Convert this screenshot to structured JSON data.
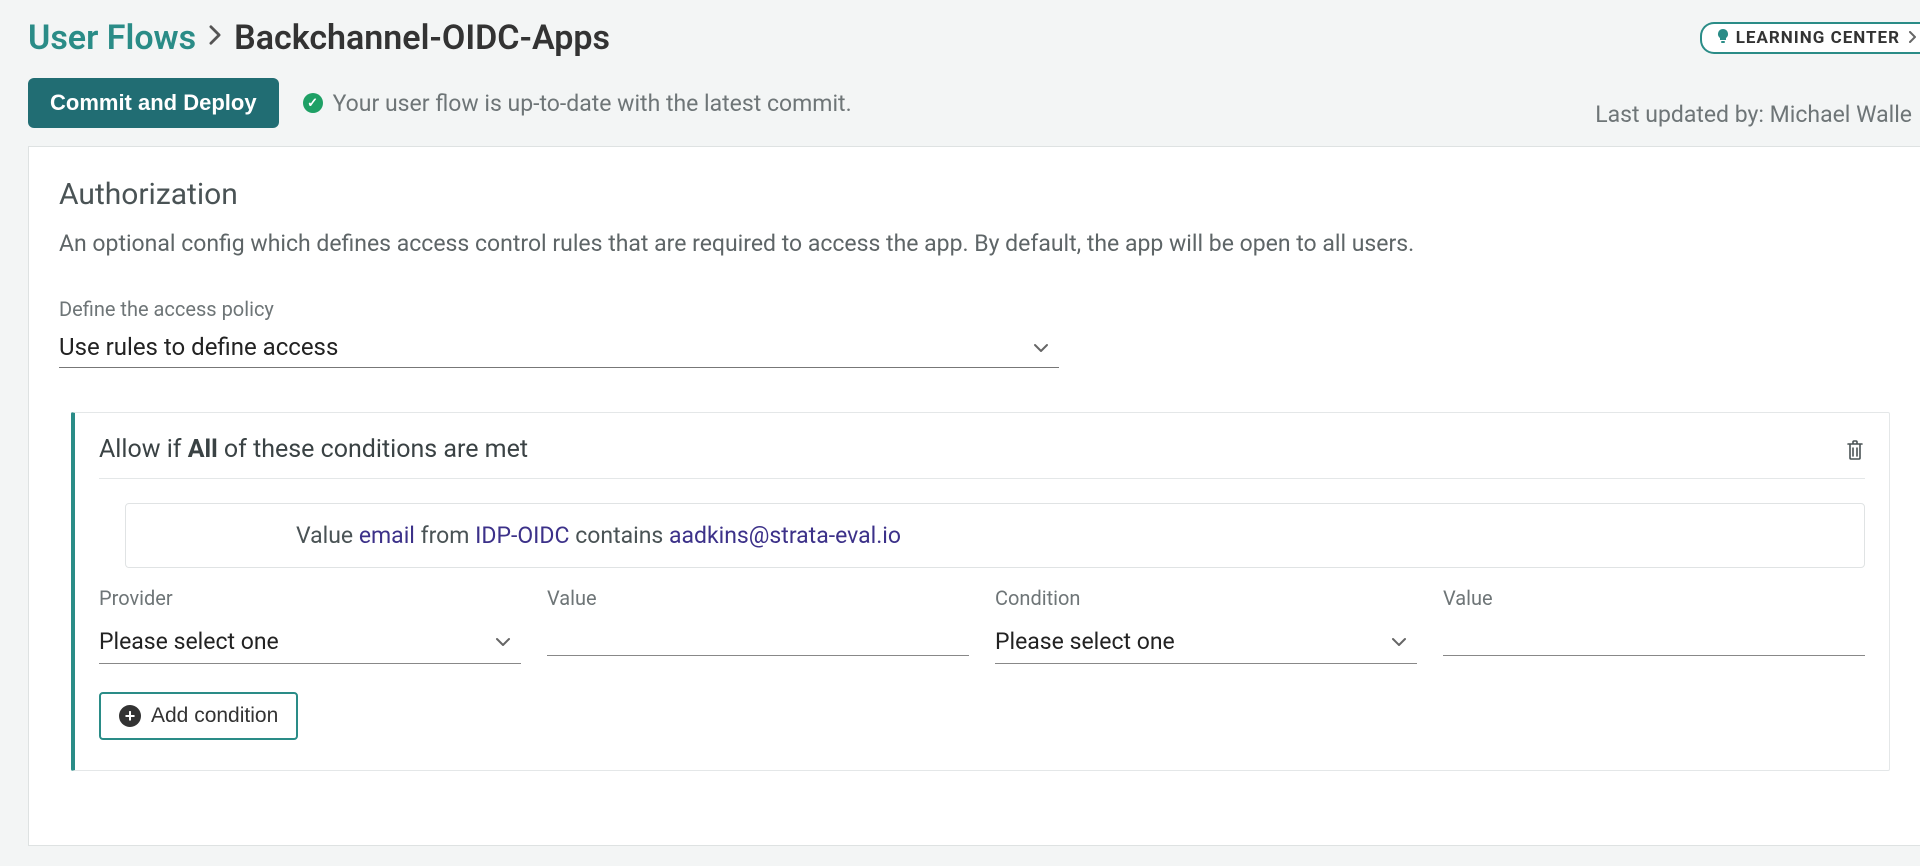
{
  "breadcrumb": {
    "root": "User Flows",
    "leaf": "Backchannel-OIDC-Apps"
  },
  "commit": {
    "button": "Commit and Deploy",
    "status": "Your user flow is up-to-date with the latest commit.",
    "last_updated": "Last updated by: Michael Walle"
  },
  "learning_center": {
    "label": "LEARNING CENTER"
  },
  "section": {
    "title": "Authorization",
    "desc": "An optional config which defines access control rules that are required to access the app. By default, the app will be open to all users."
  },
  "policy": {
    "label": "Define the access policy",
    "value": "Use rules to define access"
  },
  "rule": {
    "title_prefix": "Allow if ",
    "title_bold": "All",
    "title_suffix": " of these conditions are met",
    "existing": {
      "prefix": "Value ",
      "value1": "email",
      "mid1": " from ",
      "value2": "IDP-OIDC",
      "mid2": " contains ",
      "value3": "aadkins@strata-eval.io"
    },
    "new": {
      "provider_label": "Provider",
      "provider_value": "Please select one",
      "value1_label": "Value",
      "value1_value": "",
      "condition_label": "Condition",
      "condition_value": "Please select one",
      "value2_label": "Value",
      "value2_value": ""
    },
    "add_button": "Add condition"
  }
}
